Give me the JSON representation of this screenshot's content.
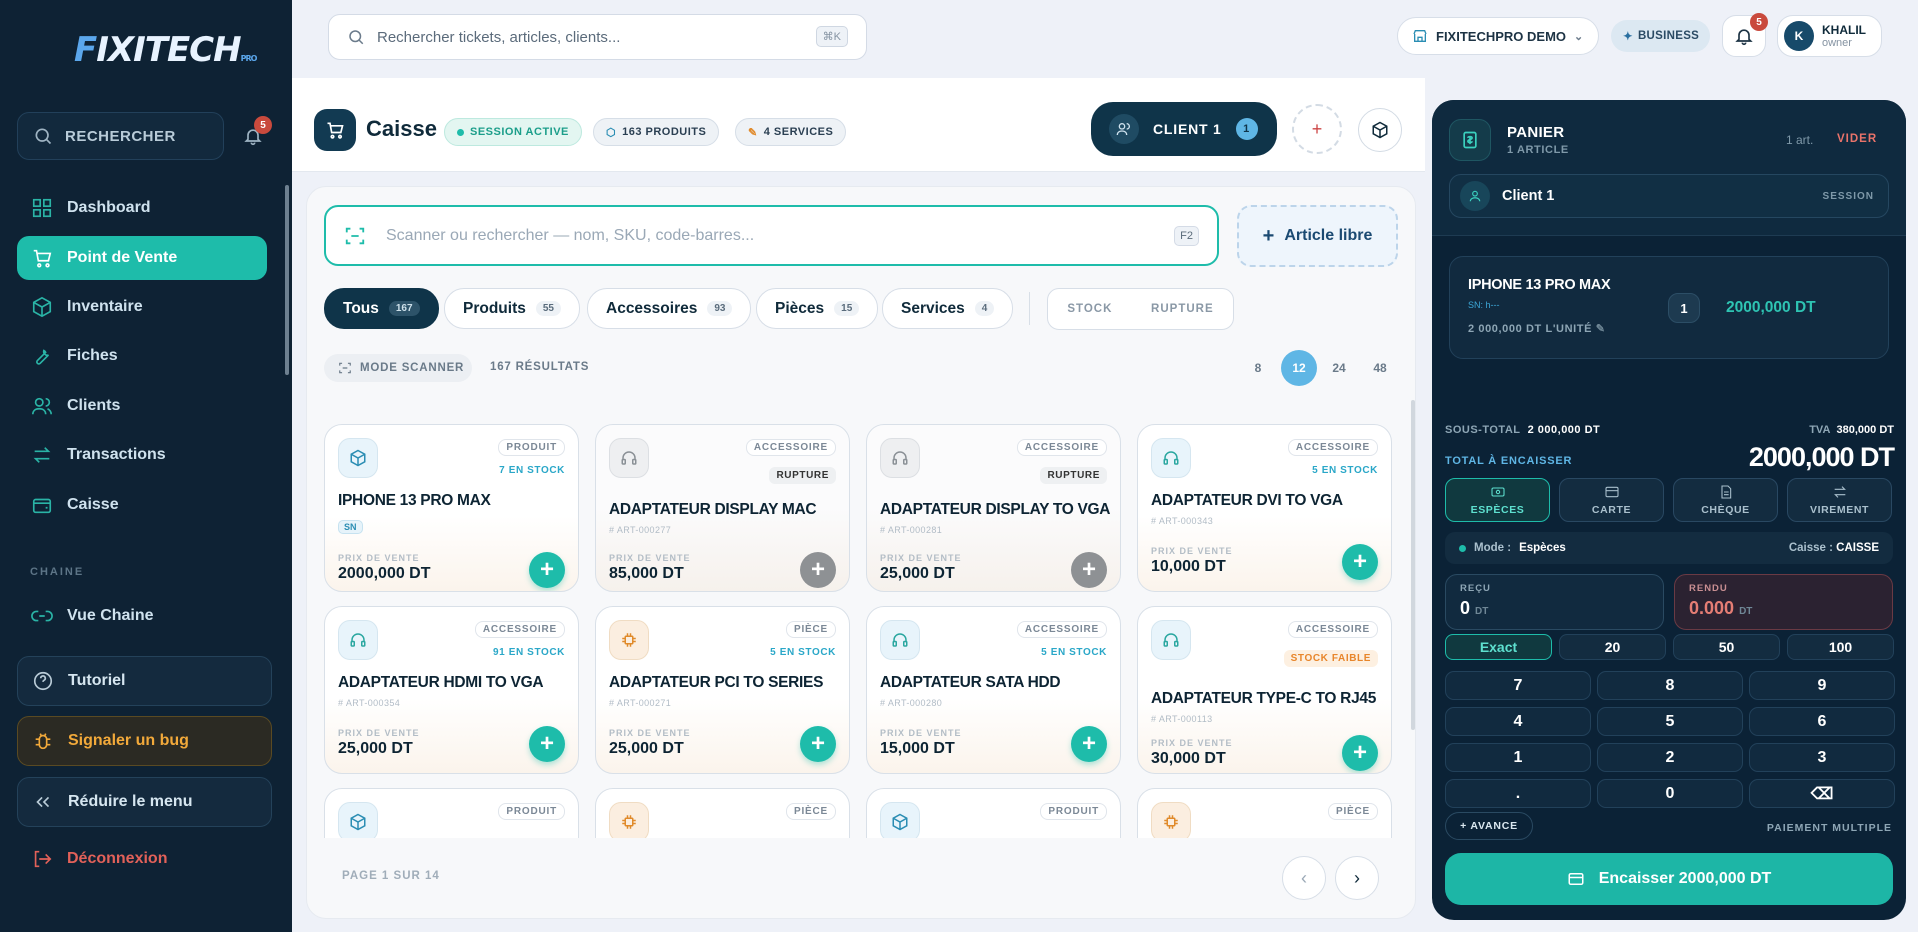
{
  "brand": {
    "logo_text": "FIXITECH",
    "logo_sub": "PRO"
  },
  "sidebar": {
    "search_label": "RECHERCHER",
    "notif_count": "5",
    "items": [
      {
        "label": "Dashboard",
        "icon": "dashboard-icon"
      },
      {
        "label": "Point de Vente",
        "icon": "cart-icon",
        "active": true
      },
      {
        "label": "Inventaire",
        "icon": "box-icon"
      },
      {
        "label": "Fiches",
        "icon": "wrench-icon"
      },
      {
        "label": "Clients",
        "icon": "users-icon"
      },
      {
        "label": "Transactions",
        "icon": "transfer-icon"
      },
      {
        "label": "Caisse",
        "icon": "wallet-icon"
      }
    ],
    "section_chain": "CHAINE",
    "chain_item": "Vue Chaine",
    "tutorial": "Tutoriel",
    "bug": "Signaler un bug",
    "collapse": "Réduire le menu",
    "logout": "Déconnexion"
  },
  "topbar": {
    "search_placeholder": "Rechercher tickets, articles, clients...",
    "search_shortcut": "⌘K",
    "org": "FIXITECHPRO DEMO",
    "plan": "BUSINESS",
    "notif_count": "5",
    "user_initial": "K",
    "user_name": "KHALIL",
    "user_role": "owner"
  },
  "caisse": {
    "title": "Caisse",
    "session": "SESSION ACTIVE",
    "products_pill": "163 PRODUITS",
    "services_pill": "4 SERVICES",
    "client_label": "CLIENT 1",
    "client_count": "1"
  },
  "catalog": {
    "search_placeholder": "Scanner ou rechercher — nom, SKU, code-barres...",
    "search_shortcut": "F2",
    "free_item": "Article libre",
    "tabs": [
      {
        "label": "Tous",
        "count": "167",
        "active": true
      },
      {
        "label": "Produits",
        "count": "55"
      },
      {
        "label": "Accessoires",
        "count": "93"
      },
      {
        "label": "Pièces",
        "count": "15"
      },
      {
        "label": "Services",
        "count": "4"
      }
    ],
    "filter_stock": "STOCK",
    "filter_rupture": "RUPTURE",
    "scanner_mode": "MODE SCANNER",
    "results": "167 RÉSULTATS",
    "page_sizes": [
      "8",
      "12",
      "24",
      "48"
    ],
    "page_size_selected": "12",
    "price_label": "PRIX DE VENTE",
    "products": [
      {
        "type": "PRODUIT",
        "stock": "7 EN STOCK",
        "name": "IPHONE 13 PRO MAX",
        "sku": "",
        "sn": "SN",
        "price": "2000,000 DT",
        "icon": "cube-icon",
        "status": "ok"
      },
      {
        "type": "ACCESSOIRE",
        "stock": "RUPTURE",
        "name": "ADAPTATEUR DISPLAY MAC",
        "sku": "ART-000277",
        "price": "85,000 DT",
        "icon": "headphones-icon",
        "status": "out"
      },
      {
        "type": "ACCESSOIRE",
        "stock": "RUPTURE",
        "name": "ADAPTATEUR DISPLAY TO VGA",
        "sku": "ART-000281",
        "price": "25,000 DT",
        "icon": "headphones-icon",
        "status": "out"
      },
      {
        "type": "ACCESSOIRE",
        "stock": "5 EN STOCK",
        "name": "ADAPTATEUR DVI TO VGA",
        "sku": "ART-000343",
        "price": "10,000 DT",
        "icon": "headphones-icon",
        "status": "ok"
      },
      {
        "type": "ACCESSOIRE",
        "stock": "91 EN STOCK",
        "name": "ADAPTATEUR HDMI TO VGA",
        "sku": "ART-000354",
        "price": "25,000 DT",
        "icon": "headphones-icon",
        "status": "ok"
      },
      {
        "type": "PIÈCE",
        "stock": "5 EN STOCK",
        "name": "ADAPTATEUR PCI TO SERIES",
        "sku": "ART-000271",
        "price": "25,000 DT",
        "icon": "chip-icon",
        "status": "ok"
      },
      {
        "type": "ACCESSOIRE",
        "stock": "5 EN STOCK",
        "name": "ADAPTATEUR SATA HDD",
        "sku": "ART-000280",
        "price": "15,000 DT",
        "icon": "headphones-icon",
        "status": "ok"
      },
      {
        "type": "ACCESSOIRE",
        "stock": "STOCK FAIBLE",
        "name": "ADAPTATEUR TYPE-C TO RJ45",
        "sku": "ART-000113",
        "price": "30,000 DT",
        "icon": "headphones-icon",
        "status": "low"
      },
      {
        "type": "PRODUIT",
        "stock": "",
        "name": "",
        "sku": "",
        "price": "",
        "icon": "cube-icon",
        "status": "ok"
      },
      {
        "type": "PIÈCE",
        "stock": "",
        "name": "",
        "sku": "",
        "price": "",
        "icon": "chip-icon",
        "status": "ok"
      },
      {
        "type": "PRODUIT",
        "stock": "",
        "name": "",
        "sku": "",
        "price": "",
        "icon": "cube-icon",
        "status": "ok"
      },
      {
        "type": "PIÈCE",
        "stock": "",
        "name": "",
        "sku": "",
        "price": "",
        "icon": "chip-icon",
        "status": "ok"
      }
    ],
    "pagination": "PAGE 1 SUR 14"
  },
  "cart": {
    "title": "PANIER",
    "subtitle": "1 ARTICLE",
    "count": "1 art.",
    "clear": "VIDER",
    "client": "Client 1",
    "client_tag": "SESSION",
    "item": {
      "name": "IPHONE 13 PRO MAX",
      "sn": "SN: h---",
      "unit": "2 000,000 DT L'UNITÉ",
      "qty": "1",
      "price": "2000,000 DT"
    },
    "subtotal_label": "SOUS-TOTAL",
    "subtotal": "2 000,000 DT",
    "tva_label": "TVA",
    "tva": "380,000 DT",
    "total_label": "TOTAL À ENCAISSER",
    "total": "2000,000 DT",
    "methods": [
      "ESPÈCES",
      "CARTE",
      "CHÈQUE",
      "VIREMENT"
    ],
    "mode_label": "Mode :",
    "mode_value": "Espèces",
    "register_label": "Caisse :",
    "register_value": "CAISSE",
    "received_label": "REÇU",
    "received": "0",
    "change_label": "RENDU",
    "change": "0.000",
    "currency": "DT",
    "quick": [
      "Exact",
      "20",
      "50",
      "100"
    ],
    "keys": [
      "7",
      "8",
      "9",
      "4",
      "5",
      "6",
      "1",
      "2",
      "3",
      ".",
      "0",
      "⌫"
    ],
    "advance": "+ AVANCE",
    "multi": "PAIEMENT MULTIPLE",
    "checkout": "Encaisser 2000,000 DT"
  }
}
